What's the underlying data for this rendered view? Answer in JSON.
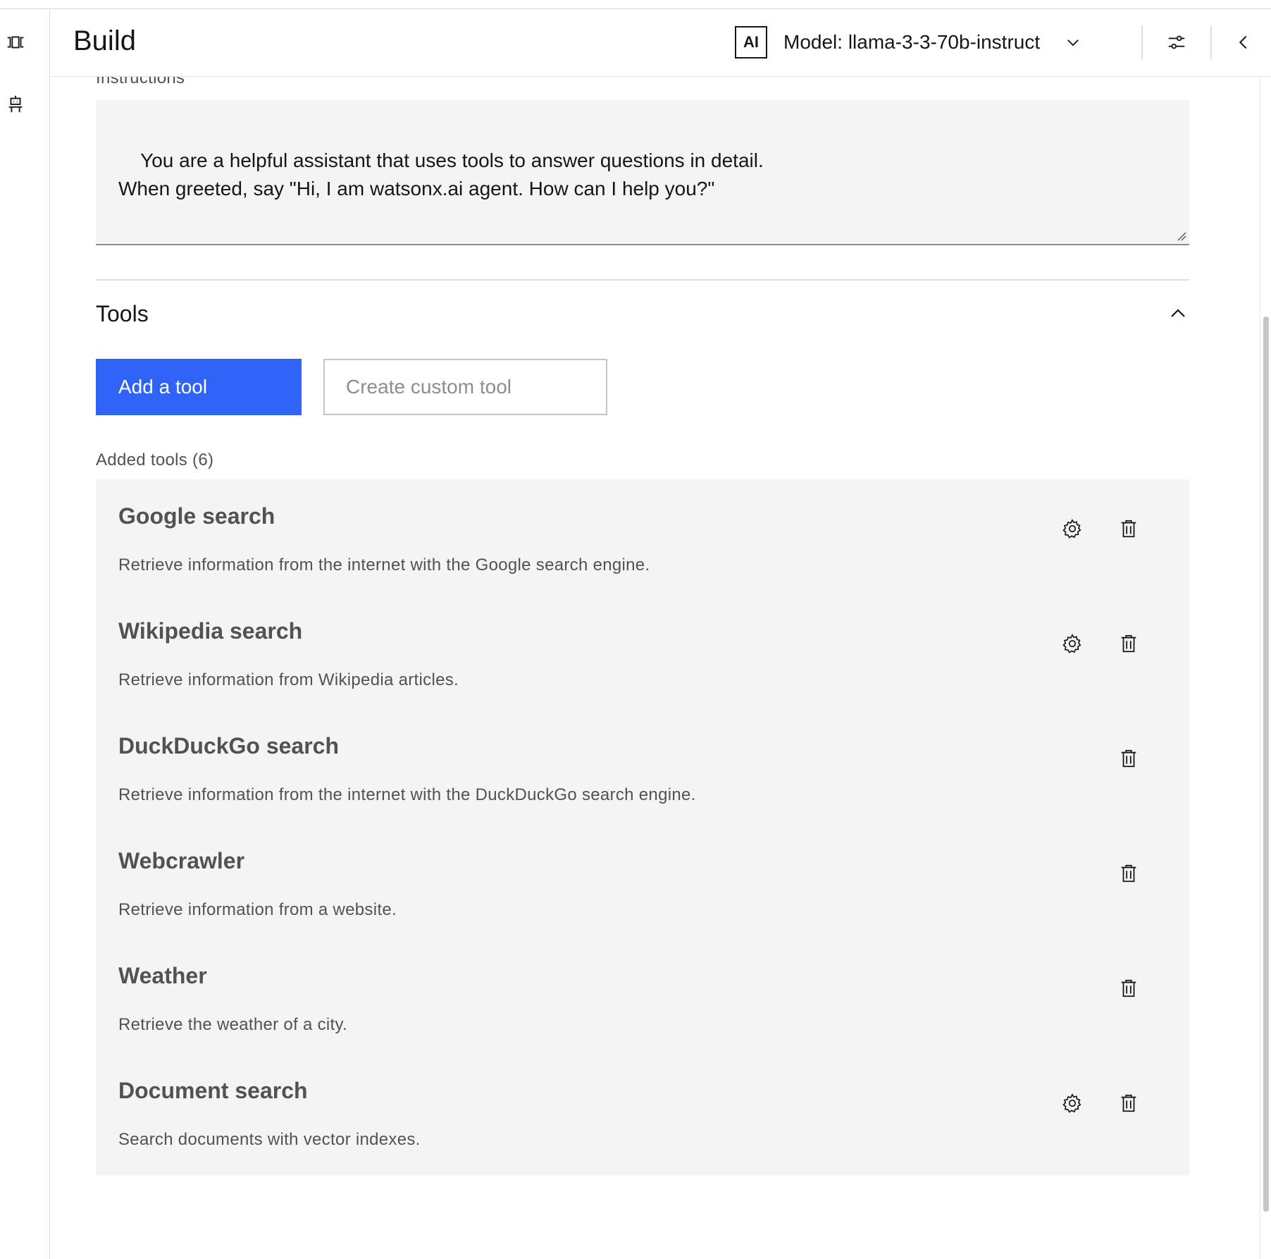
{
  "header": {
    "title": "Build",
    "ai_badge": "AI",
    "model_label": "Model: llama-3-3-70b-instruct"
  },
  "rail": {
    "items": [
      {
        "icon": "carousel-icon"
      },
      {
        "icon": "agent-icon"
      }
    ]
  },
  "instructions": {
    "label": "Instructions",
    "value": "You are a helpful assistant that uses tools to answer questions in detail.\nWhen greeted, say \"Hi, I am watsonx.ai agent. How can I help you?\""
  },
  "tools": {
    "heading": "Tools",
    "add_button": "Add a tool",
    "custom_button": "Create custom tool",
    "added_label": "Added tools (6)",
    "items": [
      {
        "name": "Google search",
        "description": "Retrieve information from the internet with the Google search engine.",
        "has_settings": true
      },
      {
        "name": "Wikipedia search",
        "description": "Retrieve information from Wikipedia articles.",
        "has_settings": true
      },
      {
        "name": "DuckDuckGo search",
        "description": "Retrieve information from the internet with the DuckDuckGo search engine.",
        "has_settings": false
      },
      {
        "name": "Webcrawler",
        "description": "Retrieve information from a website.",
        "has_settings": false
      },
      {
        "name": "Weather",
        "description": "Retrieve the weather of a city.",
        "has_settings": false
      },
      {
        "name": "Document search",
        "description": "Search documents with vector indexes.",
        "has_settings": true
      }
    ]
  },
  "colors": {
    "primary": "#2f63f5",
    "field_bg": "#f4f4f4",
    "text": "#161616",
    "secondary_text": "#525252"
  }
}
